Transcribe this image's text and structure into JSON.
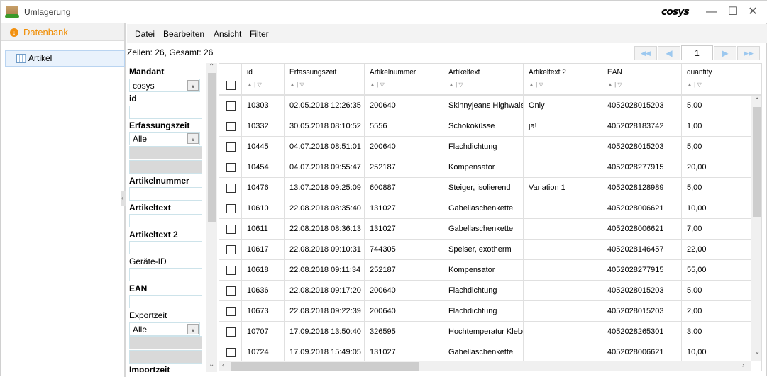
{
  "window": {
    "title": "Umlagerung",
    "logo": "cosys",
    "minimize": "—",
    "maximize": "☐",
    "close": "✕"
  },
  "sidebar": {
    "header": "Datenbank",
    "items": [
      {
        "label": "Artikel"
      }
    ]
  },
  "menu": [
    "Datei",
    "Bearbeiten",
    "Ansicht",
    "Filter"
  ],
  "status": "Zeilen: 26, Gesamt: 26",
  "pager": {
    "page": "1",
    "first": "◀◀",
    "prev": "◀",
    "next": "▶",
    "last": "▶▶"
  },
  "filters": {
    "mandant_label": "Mandant",
    "mandant_value": "cosys",
    "id_label": "id",
    "erfassungszeit_label": "Erfassungszeit",
    "erfassungszeit_value": "Alle",
    "artikelnummer_label": "Artikelnummer",
    "artikeltext_label": "Artikeltext",
    "artikeltext2_label": "Artikeltext 2",
    "geraete_label": "Geräte-ID",
    "ean_label": "EAN",
    "exportzeit_label": "Exportzeit",
    "exportzeit_value": "Alle",
    "importzeit_label": "Importzeit"
  },
  "table": {
    "columns": [
      "id",
      "Erfassungszeit",
      "Artikelnummer",
      "Artikeltext",
      "Artikeltext 2",
      "EAN",
      "quantity"
    ],
    "sort_glyph": "▲ | ▽",
    "rows": [
      [
        "10303",
        "02.05.2018 12:26:35",
        "200640",
        "Skinnyjeans Highwaist",
        "Only",
        "4052028015203",
        "5,00"
      ],
      [
        "10332",
        "30.05.2018 08:10:52",
        "5556",
        "Schokoküsse",
        "ja!",
        "4052028183742",
        "1,00"
      ],
      [
        "10445",
        "04.07.2018 08:51:01",
        "200640",
        "Flachdichtung",
        "",
        "4052028015203",
        "5,00"
      ],
      [
        "10454",
        "04.07.2018 09:55:47",
        "252187",
        "Kompensator",
        "",
        "4052028277915",
        "20,00"
      ],
      [
        "10476",
        "13.07.2018 09:25:09",
        "600887",
        "Steiger, isolierend",
        "Variation 1",
        "4052028128989",
        "5,00"
      ],
      [
        "10610",
        "22.08.2018 08:35:40",
        "131027",
        "Gabellaschenkette",
        "",
        "4052028006621",
        "10,00"
      ],
      [
        "10611",
        "22.08.2018 08:36:13",
        "131027",
        "Gabellaschenkette",
        "",
        "4052028006621",
        "7,00"
      ],
      [
        "10617",
        "22.08.2018 09:10:31",
        "744305",
        "Speiser, exotherm",
        "",
        "4052028146457",
        "22,00"
      ],
      [
        "10618",
        "22.08.2018 09:11:34",
        "252187",
        "Kompensator",
        "",
        "4052028277915",
        "55,00"
      ],
      [
        "10636",
        "22.08.2018 09:17:20",
        "200640",
        "Flachdichtung",
        "",
        "4052028015203",
        "5,00"
      ],
      [
        "10673",
        "22.08.2018 09:22:39",
        "200640",
        "Flachdichtung",
        "",
        "4052028015203",
        "2,00"
      ],
      [
        "10707",
        "17.09.2018 13:50:40",
        "326595",
        "Hochtemperatur Kleber",
        "",
        "4052028265301",
        "3,00"
      ],
      [
        "10724",
        "17.09.2018 15:49:05",
        "131027",
        "Gabellaschenkette",
        "",
        "4052028006621",
        "10,00"
      ]
    ]
  },
  "colors": {
    "accent": "#f08c00",
    "selection": "#e9f2fc",
    "pager_arrow": "#9cc8ef"
  }
}
